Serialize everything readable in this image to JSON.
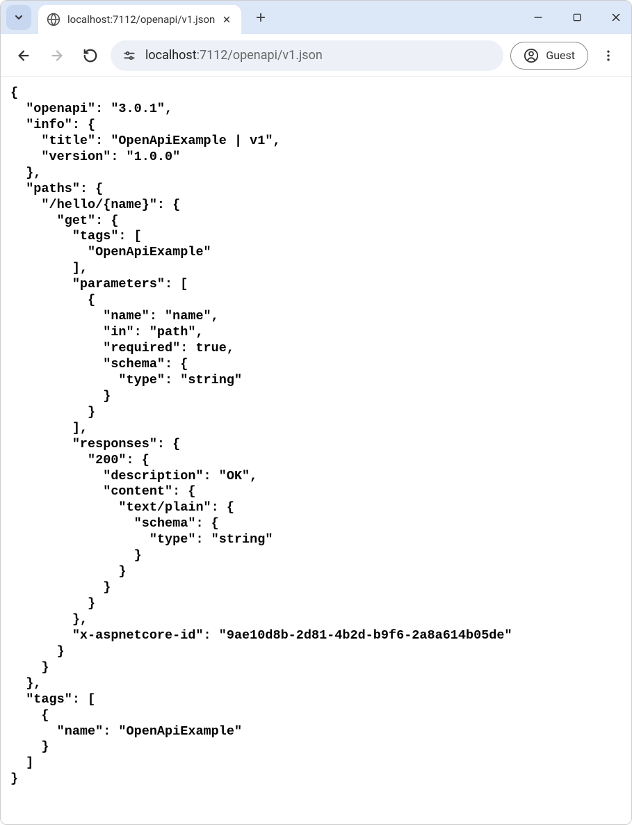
{
  "tab": {
    "title": "localhost:7112/openapi/v1.json"
  },
  "toolbar": {
    "url_host": "localhost",
    "url_path": ":7112/openapi/v1.json",
    "guest_label": "Guest"
  },
  "json_body": "{\n  \"openapi\": \"3.0.1\",\n  \"info\": {\n    \"title\": \"OpenApiExample | v1\",\n    \"version\": \"1.0.0\"\n  },\n  \"paths\": {\n    \"/hello/{name}\": {\n      \"get\": {\n        \"tags\": [\n          \"OpenApiExample\"\n        ],\n        \"parameters\": [\n          {\n            \"name\": \"name\",\n            \"in\": \"path\",\n            \"required\": true,\n            \"schema\": {\n              \"type\": \"string\"\n            }\n          }\n        ],\n        \"responses\": {\n          \"200\": {\n            \"description\": \"OK\",\n            \"content\": {\n              \"text/plain\": {\n                \"schema\": {\n                  \"type\": \"string\"\n                }\n              }\n            }\n          }\n        },\n        \"x-aspnetcore-id\": \"9ae10d8b-2d81-4b2d-b9f6-2a8a614b05de\"\n      }\n    }\n  },\n  \"tags\": [\n    {\n      \"name\": \"OpenApiExample\"\n    }\n  ]\n}"
}
